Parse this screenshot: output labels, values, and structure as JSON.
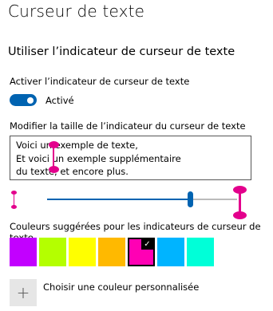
{
  "page": {
    "title": "Curseur de texte"
  },
  "section": {
    "heading": "Utiliser l’indicateur de curseur de texte"
  },
  "toggle": {
    "label": "Activer l’indicateur de curseur de texte",
    "state": "Activé",
    "on": true,
    "accent": "#0063b1"
  },
  "size": {
    "label": "Modifier la taille de l’indicateur du curseur de texte",
    "preview_lines": [
      "Voici un exemple de texte,",
      "Et voici un exemple supplémentaire",
      "du texte, et encore plus."
    ],
    "slider_level": 0.76
  },
  "colors": {
    "label": "Couleurs suggérées pour les indicateurs de curseur de texte",
    "swatches": [
      "#c200ff",
      "#b4ff00",
      "#ffff00",
      "#ffb900",
      "#ff00b4",
      "#00b4ff",
      "#00ffd8"
    ],
    "selected_index": 4,
    "indicator_color": "#e3008c"
  },
  "custom": {
    "label": "Choisir une couleur personnalisée",
    "icon": "plus-icon"
  }
}
